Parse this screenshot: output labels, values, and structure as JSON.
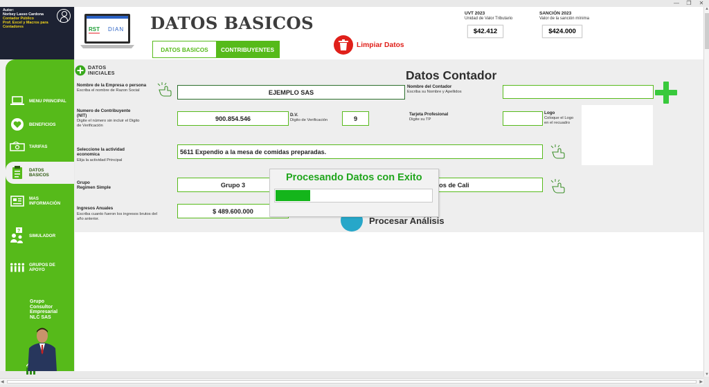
{
  "author": {
    "line1": "Autor:",
    "line2": "Norbey Lasso Cardona",
    "line3": "Contador Público",
    "line4": "Prof. Excel y Macros para",
    "line5": "Contadores"
  },
  "nav": {
    "items": [
      {
        "label": "MENU PRINCIPAL",
        "icon": "laptop-icon"
      },
      {
        "label": "BENEFICIOS",
        "icon": "heart-icon"
      },
      {
        "label": "TARIFAS",
        "icon": "cash-icon"
      },
      {
        "label": "DATOS BASICOS",
        "icon": "clipboard-icon",
        "active": true
      },
      {
        "label": "MAS INFORMACIÓN",
        "icon": "newspaper-icon"
      },
      {
        "label": "SIMULADOR",
        "icon": "people-question-icon"
      },
      {
        "label": "GRUPOS DE APOYO",
        "icon": "group-icon"
      }
    ],
    "company": {
      "l1": "Grupo",
      "l2": "Consultor",
      "l3": "Empresarial",
      "l4": "NLC SAS"
    }
  },
  "header": {
    "title": "DATOS BASICOS",
    "tabs": [
      "DATOS BASICOS",
      "CONTRIBUYENTES"
    ],
    "clear_label": "Limpiar Datos",
    "laptop_logos": {
      "rst": "RST",
      "dian": "DIAN"
    },
    "uvt": {
      "title": "UVT 2023",
      "subtitle": "Unidad de Valor Tributario",
      "value": "$42.412"
    },
    "sancion": {
      "title": "SANCIÓN 2023",
      "subtitle": "Valor de la sanción mínima",
      "value": "$424.000"
    }
  },
  "form": {
    "section_l1": "DATOS",
    "section_l2": "INICIALES",
    "empresa": {
      "label": "Nombre de la Empresa o persona",
      "hint": "Escriba el nombre de Razon Social",
      "value": "EJEMPLO SAS"
    },
    "nit": {
      "label_l1": "Numero de Contribuyente",
      "label_l2": "(NIT)",
      "hint_l1": "Digite el número sin incluir el Digito",
      "hint_l2": "de Verificación",
      "value": "900.854.546"
    },
    "dv": {
      "label": "D.V.",
      "hint": "Digito de Verificación",
      "value": "9"
    },
    "actividad": {
      "label_l1": "Seleccione la actividad",
      "label_l2": "economica",
      "hint": "Elija la actividad Principal",
      "value": "5611 Expendio a la mesa de comidas preparadas."
    },
    "grupo": {
      "label_l1": "Grupo",
      "label_l2": "Regimen Simple",
      "value": "Grupo 3"
    },
    "ciudad": {
      "value": "stos de Cali"
    },
    "ingresos": {
      "label": "Ingresos Anuales",
      "hint_l1": "Escriba cuanto fueron los ingresos brutos del",
      "hint_l2": "año anterior.",
      "value": "$ 489.600.000"
    },
    "contador_title": "Datos Contador",
    "contador": {
      "label": "Nombre del Contador",
      "hint": "Escriba su Nombre y Apellidos",
      "value": ""
    },
    "tarjeta": {
      "label": "Tarjeta Profesional",
      "hint": "Digite su TP",
      "value": ""
    },
    "logo": {
      "label": "Logo",
      "hint_l1": "Coloque el Logo",
      "hint_l2": "en el recuadro"
    }
  },
  "dialog": {
    "title": "Procesando Datos con Exito",
    "progress": 0.22
  },
  "procesar_label": "Procesar Análisis",
  "colors": {
    "green": "#56ba1a",
    "red": "#e0201a",
    "dark": "#1d2233"
  }
}
